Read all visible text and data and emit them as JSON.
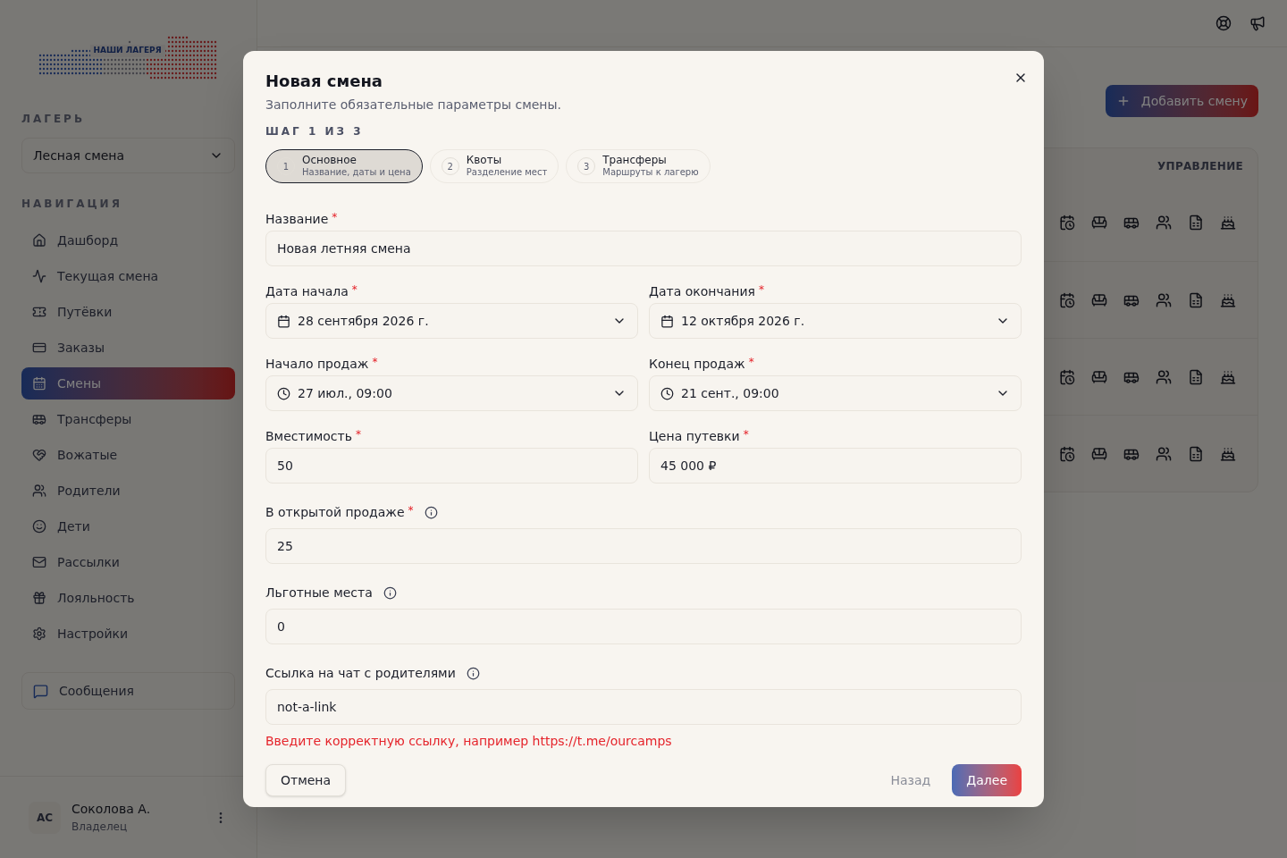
{
  "sidebar": {
    "logo_text": "НАШИ ЛАГЕРЯ",
    "camp_label": "ЛАГЕРЬ",
    "camp_select": {
      "value": "Лесная смена"
    },
    "nav_label": "НАВИГАЦИЯ",
    "items": [
      {
        "label": "Дашборд",
        "selected": false
      },
      {
        "label": "Текущая смена",
        "selected": false
      },
      {
        "label": "Путёвки",
        "selected": false
      },
      {
        "label": "Заказы",
        "selected": false
      },
      {
        "label": "Смены",
        "selected": true
      },
      {
        "label": "Трансферы",
        "selected": false
      },
      {
        "label": "Вожатые",
        "selected": false
      },
      {
        "label": "Родители",
        "selected": false
      },
      {
        "label": "Дети",
        "selected": false
      },
      {
        "label": "Рассылки",
        "selected": false
      },
      {
        "label": "Лояльность",
        "selected": false
      },
      {
        "label": "Настройки",
        "selected": false
      }
    ],
    "messages_button": "Сообщения",
    "user": {
      "initials": "АС",
      "name": "Соколова А.",
      "role": "Владелец"
    }
  },
  "main": {
    "add_button": "Добавить смену",
    "table": {
      "columns": [
        "УПРАВЛЕНИЕ"
      ]
    }
  },
  "dialog": {
    "title": "Новая смена",
    "subtitle": "Заполните обязательные параметры смены.",
    "step_label": "ШАГ 1 ИЗ 3",
    "steps": [
      {
        "number": "1",
        "title": "Основное",
        "subtitle": "Название, даты и цена",
        "selected": true
      },
      {
        "number": "2",
        "title": "Квоты",
        "subtitle": "Разделение мест",
        "selected": false
      },
      {
        "number": "3",
        "title": "Трансферы",
        "subtitle": "Маршруты к лагерю",
        "selected": false
      }
    ],
    "rows": [
      [
        {
          "label": "Название",
          "required_mark": "*",
          "kind": "text",
          "value": "Новая летняя смена"
        }
      ],
      [
        {
          "label": "Дата начала",
          "required_mark": "*",
          "kind": "date",
          "value": "28 сентября 2026 г."
        },
        {
          "label": "Дата окончания",
          "required_mark": "*",
          "kind": "date",
          "value": "12 октября 2026 г."
        }
      ],
      [
        {
          "label": "Начало продаж",
          "required_mark": "*",
          "kind": "time",
          "value": "27 июл., 09:00"
        },
        {
          "label": "Конец продаж",
          "required_mark": "*",
          "kind": "time",
          "value": "21 сент., 09:00"
        }
      ],
      [
        {
          "label": "Вместимость",
          "required_mark": "*",
          "kind": "text",
          "value": "50"
        },
        {
          "label": "Цена путевки",
          "required_mark": "*",
          "kind": "text",
          "value": "45 000 ₽"
        }
      ],
      [
        {
          "label": "В открытой продаже",
          "required_mark": "*",
          "info": true,
          "kind": "text",
          "value": "25"
        }
      ],
      [
        {
          "label": "Льготные места",
          "info": true,
          "kind": "text",
          "value": "0"
        }
      ],
      [
        {
          "label": "Ссылка на чат с родителями",
          "info": true,
          "kind": "text",
          "value": "not-a-link",
          "error": "Введите корректную ссылку, например https://t.me/ourcamps"
        }
      ]
    ],
    "cancel_button": "Отмена",
    "back_button": "Назад",
    "next_button": "Далее"
  }
}
